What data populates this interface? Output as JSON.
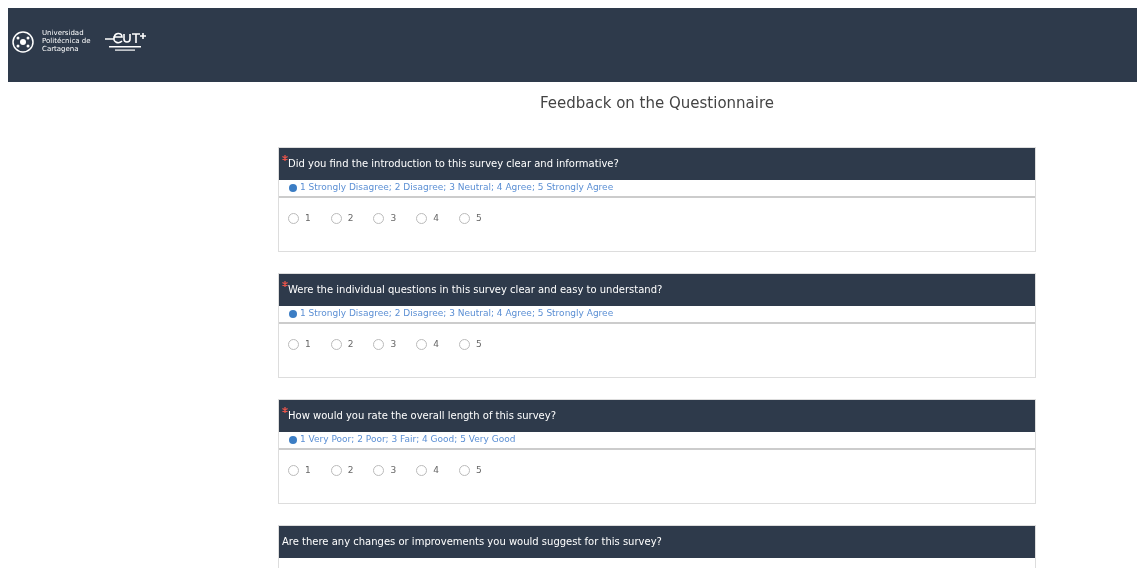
{
  "header": {
    "logo_text": "Universidad Politécnica de Cartagena"
  },
  "title": "Feedback on the Questionnaire",
  "questions": [
    {
      "kind": "rating",
      "required": true,
      "text": "Did you find the introduction to this survey clear and informative?",
      "hint": "1 Strongly Disagree; 2 Disagree; 3 Neutral; 4 Agree; 5 Strongly Agree",
      "options": [
        {
          "label": "1",
          "selected": false
        },
        {
          "label": "2",
          "selected": false
        },
        {
          "label": "3",
          "selected": false
        },
        {
          "label": "4",
          "selected": false
        },
        {
          "label": "5",
          "selected": false
        }
      ]
    },
    {
      "kind": "rating",
      "required": true,
      "text": "Were the individual questions in this survey clear and easy to understand?",
      "hint": "1 Strongly Disagree; 2 Disagree; 3 Neutral; 4 Agree; 5 Strongly Agree",
      "options": [
        {
          "label": "1",
          "selected": false
        },
        {
          "label": "2",
          "selected": false
        },
        {
          "label": "3",
          "selected": false
        },
        {
          "label": "4",
          "selected": false
        },
        {
          "label": "5",
          "selected": false
        }
      ]
    },
    {
      "kind": "rating",
      "required": true,
      "text": "How would you rate the overall length of this survey?",
      "hint": "1 Very Poor; 2 Poor; 3 Fair; 4 Good; 5 Very Good",
      "options": [
        {
          "label": "1",
          "selected": false
        },
        {
          "label": "2",
          "selected": false
        },
        {
          "label": "3",
          "selected": false
        },
        {
          "label": "4",
          "selected": false
        },
        {
          "label": "5",
          "selected": false
        }
      ]
    },
    {
      "kind": "text",
      "required": false,
      "text": "Are there any changes or improvements you would suggest for this survey?"
    }
  ]
}
